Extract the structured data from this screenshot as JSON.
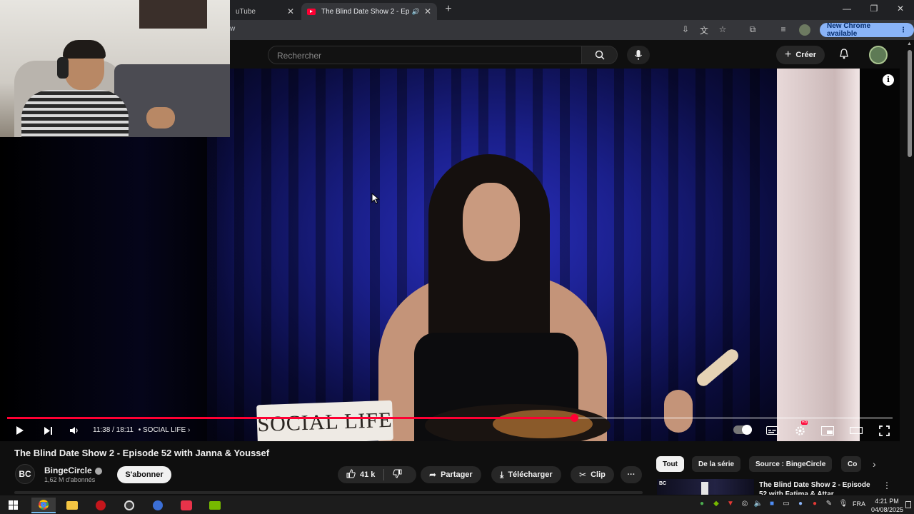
{
  "browser": {
    "tabs": [
      {
        "title": "uTube",
        "close": "✕"
      },
      {
        "title": "The Blind Date Show 2 - Ep",
        "close": "✕",
        "audio_icon": "speaker-icon"
      }
    ],
    "new_tab": "+",
    "url_fragment": "w",
    "window_controls": [
      "—",
      "❐",
      "✕"
    ],
    "new_chrome_label": "New Chrome available",
    "new_chrome_menu": "⋮"
  },
  "youtube_header": {
    "search_placeholder": "Rechercher",
    "create_label": "Créer",
    "create_plus": "+"
  },
  "player": {
    "current_time": "11:38",
    "duration": "18:11",
    "time_separator": "/",
    "chapter": "• SOCIAL LIFE",
    "chapter_arrow": "›",
    "progress_fraction": 0.64,
    "nameplate_text": "SOCIAL LIFE",
    "info_icon": "i",
    "settings_badge": "HD"
  },
  "video": {
    "title": "The Blind Date Show 2 - Episode 52 with Janna & Youssef",
    "channel": {
      "logo_text": "BC",
      "name": "BingeCircle",
      "subscribers": "1,62 M d'abonnés",
      "subscribe_label": "S'abonner"
    },
    "actions": {
      "likes": "41 k",
      "share": "Partager",
      "download": "Télécharger",
      "clip": "Clip",
      "more": "···"
    }
  },
  "related": {
    "chips": [
      "Tout",
      "De la série",
      "Source : BingeCircle",
      "Co"
    ],
    "chip_next": "›",
    "item": {
      "thumb_label": "BC",
      "title": "The Blind Date Show 2 - Episode 52 with Fatima & Attar",
      "menu": "⋮"
    }
  },
  "taskbar": {
    "language": "FRA",
    "time": "4:21 PM",
    "date": "04/08/2025"
  },
  "colors": {
    "youtube_red": "#ff0033",
    "chrome_update": "#8ab4f8",
    "background": "#0f0f0f"
  }
}
